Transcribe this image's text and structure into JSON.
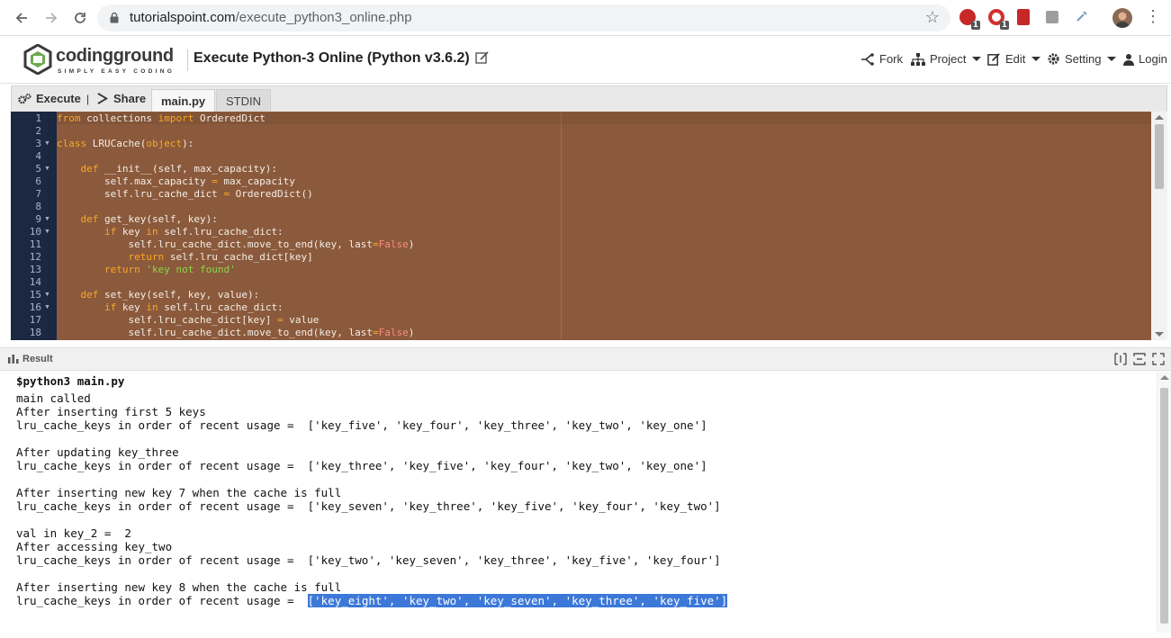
{
  "browser": {
    "url_host": "tutorialspoint.com",
    "url_path": "/execute_python3_online.php",
    "extensions": [
      {
        "name": "adblock-icon",
        "badge": "1",
        "color": "#c62828"
      },
      {
        "name": "opera-icon",
        "badge": "1",
        "color": "#d32f2f"
      },
      {
        "name": "bookmark-red-icon",
        "badge": "",
        "color": "#c62828"
      },
      {
        "name": "copy-extension-icon",
        "badge": "",
        "color": "#9e9e9e"
      },
      {
        "name": "dropper-extension-icon",
        "badge": "",
        "color": "#7e9cc0"
      }
    ]
  },
  "site": {
    "logo_word": "codingground",
    "logo_tagline": "SIMPLY EASY CODING",
    "page_title": "Execute Python-3 Online (Python v3.6.2)",
    "menu": {
      "fork": "Fork",
      "project": "Project",
      "edit": "Edit",
      "setting": "Setting",
      "login": "Login"
    }
  },
  "toolbar": {
    "execute": "Execute",
    "separator": "|",
    "share": "Share",
    "tabs": [
      "main.py",
      "STDIN"
    ]
  },
  "editor": {
    "line_numbers": [
      "1",
      "2",
      "3",
      "4",
      "5",
      "6",
      "7",
      "8",
      "9",
      "10",
      "11",
      "12",
      "13",
      "14",
      "15",
      "16",
      "17",
      "18"
    ],
    "fold_lines": [
      3,
      5,
      9,
      10,
      15,
      16
    ]
  },
  "result": {
    "title": "Result",
    "command": "$python3 main.py",
    "lines": [
      "main called",
      "After inserting first 5 keys",
      "lru_cache_keys in order of recent usage =  ['key_five', 'key_four', 'key_three', 'key_two', 'key_one']",
      "",
      "After updating key_three",
      "lru_cache_keys in order of recent usage =  ['key_three', 'key_five', 'key_four', 'key_two', 'key_one']",
      "",
      "After inserting new key 7 when the cache is full",
      "lru_cache_keys in order of recent usage =  ['key_seven', 'key_three', 'key_five', 'key_four', 'key_two']",
      "",
      "val in key_2 =  2",
      "After accessing key_two",
      "lru_cache_keys in order of recent usage =  ['key_two', 'key_seven', 'key_three', 'key_five', 'key_four']",
      "",
      "After inserting new key 8 when the cache is full"
    ],
    "last_line_prefix": "lru_cache_keys in order of recent usage =  ",
    "last_line_selected": "['key_eight', 'key_two', 'key_seven', 'key_three', 'key_five']"
  }
}
